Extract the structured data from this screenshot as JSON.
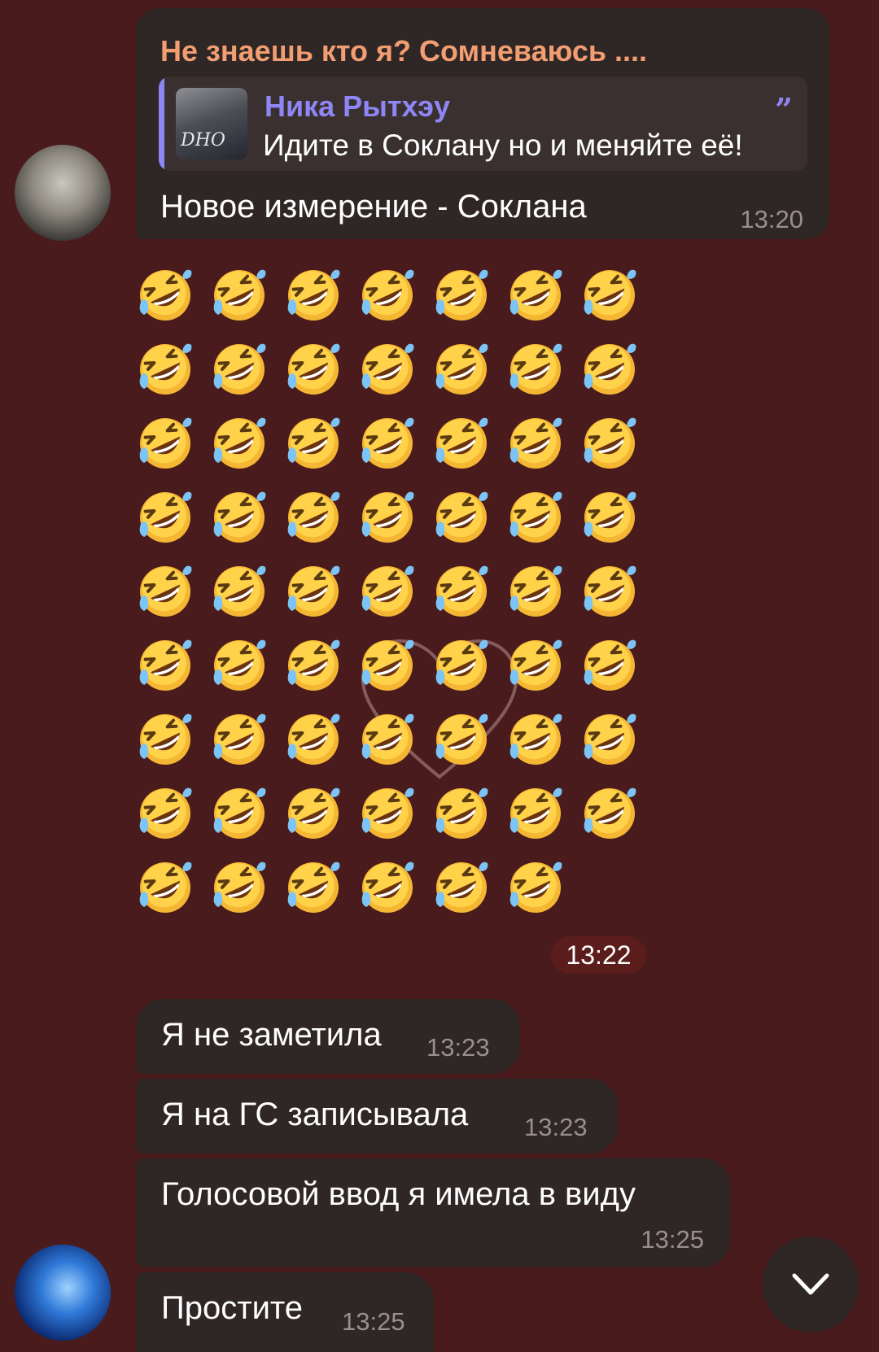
{
  "messages": {
    "first": {
      "sender": "Не знаешь кто я? Сомневаюсь ....",
      "reply": {
        "name": "Ника Рытхэу",
        "text": "Идите в Соклану но и меняйте её!",
        "thumb_text": "DHO"
      },
      "text": "Новое измерение - Соклана",
      "time": "13:20"
    },
    "emoji_message": {
      "emoji_name": "rolling-on-the-floor-laughing",
      "count": 62,
      "time": "13:22"
    },
    "second": [
      {
        "text": "Я не заметила",
        "time": "13:23"
      },
      {
        "text": "Я на ГС записывала",
        "time": "13:23"
      },
      {
        "text": "Голосовой ввод я имела в виду",
        "time": "13:25"
      },
      {
        "text": "Простите",
        "time": "13:25"
      }
    ]
  },
  "colors": {
    "background": "#4a1b1c",
    "bubble": "#2f2626",
    "sender_name": "#f29e72",
    "reply_accent": "#8f86f5",
    "time": "#9a8f8f"
  },
  "icons": {
    "scroll_down": "chevron-down-icon",
    "background_pattern": "heart-outline-icon"
  }
}
